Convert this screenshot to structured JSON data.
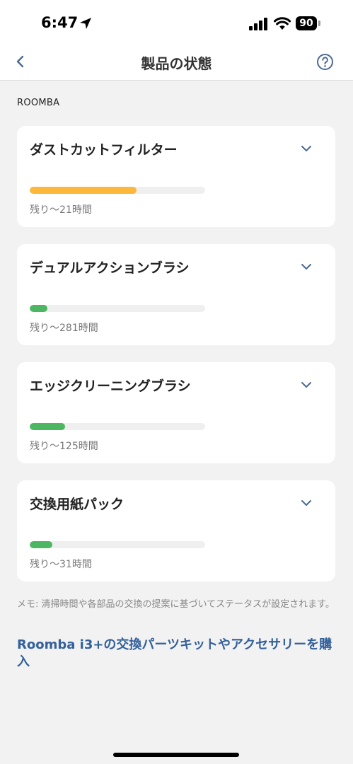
{
  "status_bar": {
    "time": "6:47",
    "battery": "90"
  },
  "header": {
    "title": "製品の状態"
  },
  "section": {
    "label": "ROOMBA"
  },
  "items": [
    {
      "name": "ダストカットフィルター",
      "remaining": "残り〜21時間",
      "progress": 0.61,
      "color": "#fbb83b"
    },
    {
      "name": "デュアルアクションブラシ",
      "remaining": "残り〜281時間",
      "progress": 0.1,
      "color": "#4cb662"
    },
    {
      "name": "エッジクリーニングブラシ",
      "remaining": "残り〜125時間",
      "progress": 0.2,
      "color": "#4cb662"
    },
    {
      "name": "交換用紙パック",
      "remaining": "残り〜31時間",
      "progress": 0.13,
      "color": "#4cb662"
    }
  ],
  "footer": {
    "note": "メモ: 清掃時間や各部品の交換の提案に基づいてステータスが設定されます。",
    "buy_link": "Roomba i3+の交換パーツキットやアクセサリーを購入"
  },
  "colors": {
    "accent": "#34609b",
    "warning": "#fbb83b",
    "good": "#4cb662"
  }
}
